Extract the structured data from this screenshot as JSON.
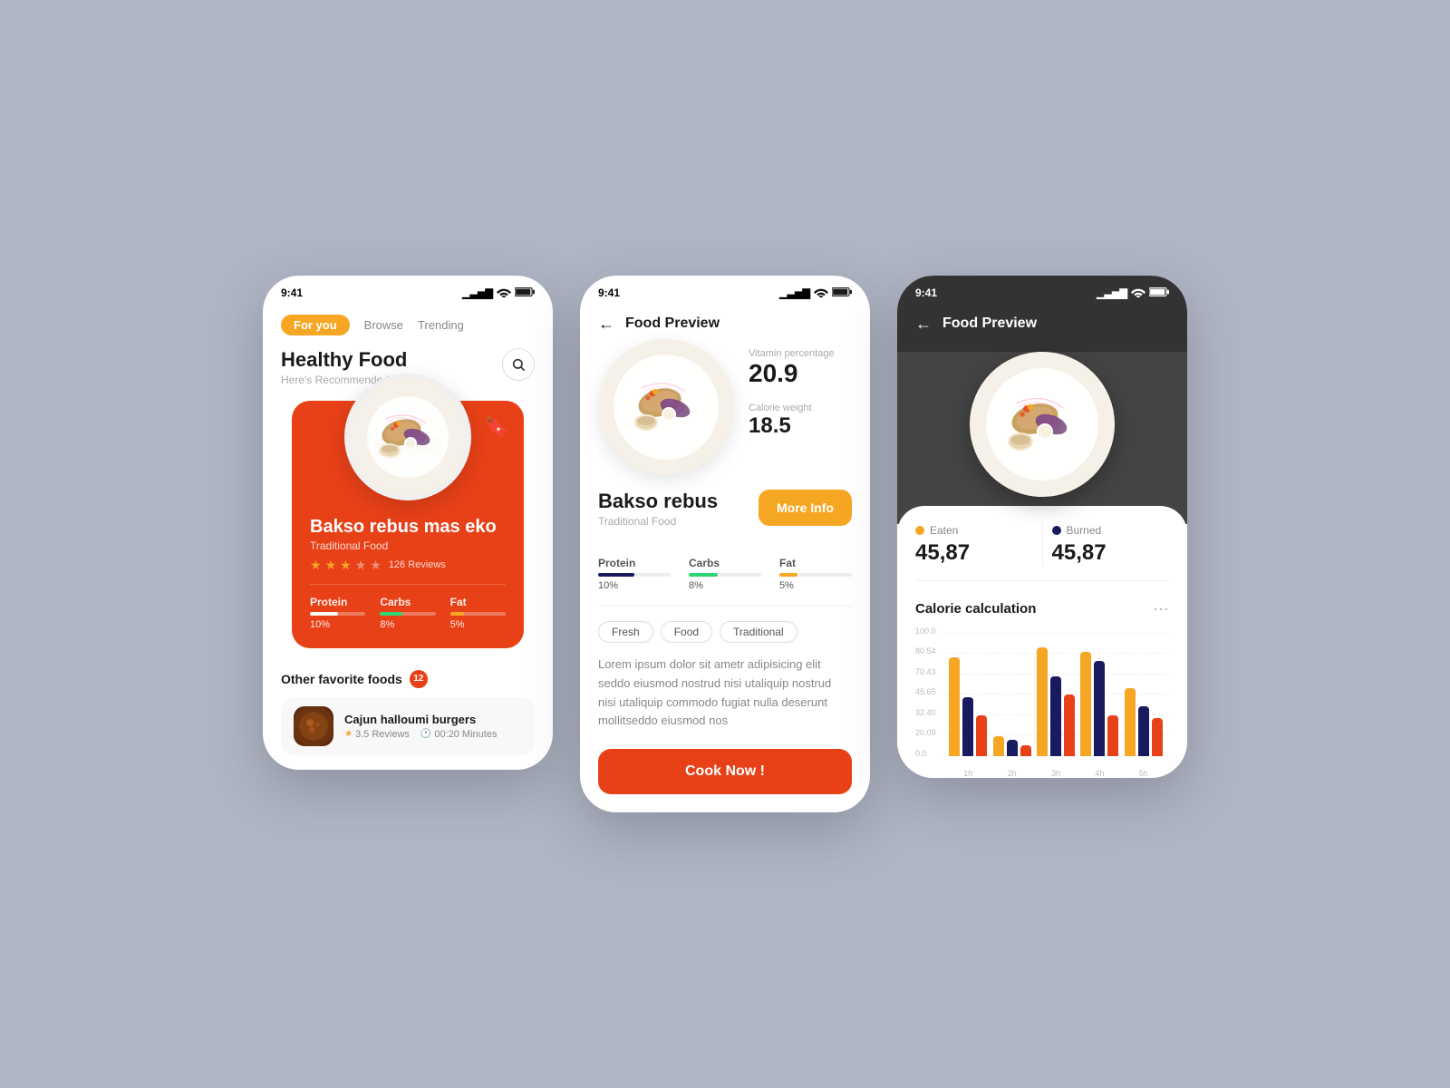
{
  "screens": {
    "screen1": {
      "status_time": "9:41",
      "tabs": [
        "For you",
        "Browse",
        "Trending"
      ],
      "active_tab": "For you",
      "header_title": "Healthy Food",
      "header_sub": "Here's Recommended for you",
      "hero": {
        "food_name": "Bakso rebus mas eko",
        "food_type": "Traditional Food",
        "rating": 2.5,
        "reviews": "126 Reviews",
        "nutrition": [
          {
            "label": "Protein",
            "pct": 10,
            "color": "#fff"
          },
          {
            "label": "Carbs",
            "pct": 8,
            "color": "#2ed573"
          },
          {
            "label": "Fat",
            "pct": 5,
            "color": "#f5a623"
          }
        ]
      },
      "other_foods_label": "Other favorite foods",
      "other_foods_count": "12",
      "food_list": [
        {
          "name": "Cajun halloumi burgers",
          "rating": "3.5 Reviews",
          "time": "00:20 Minutes"
        }
      ]
    },
    "screen2": {
      "status_time": "9:41",
      "header_title": "Food Preview",
      "back_label": "←",
      "vitamin_label": "Vitamin percentage",
      "vitamin_value": "20.9",
      "calorie_label": "Calorie weight",
      "calorie_value": "18.5",
      "food_name": "Bakso rebus",
      "food_type": "Traditional Food",
      "more_info_label": "More Info",
      "nutrition": [
        {
          "label": "Protein",
          "pct": 10,
          "color": "#1a1a5e"
        },
        {
          "label": "Carbs",
          "pct": 8,
          "color": "#2ed573"
        },
        {
          "label": "Fat",
          "pct": 5,
          "color": "#f5a623"
        }
      ],
      "tags": [
        "Fresh",
        "Food",
        "Traditional"
      ],
      "description": "Lorem ipsum dolor sit ametr adipisicing elit seddo eiusmod nostrud nisi utaliquip nostrud nisi utaliquip commodo fugiat nulla deserunt mollitseddo eiusmod nos",
      "cook_btn": "Cook Now !"
    },
    "screen3": {
      "status_time": "9:41",
      "header_title": "Food Preview",
      "back_label": "←",
      "eaten_label": "Eaten",
      "eaten_value": "45,87",
      "burned_label": "Burned",
      "burned_value": "45,87",
      "calorie_title": "Calorie calculation",
      "chart": {
        "y_labels": [
          "100.0",
          "80.54",
          "70.43",
          "45.65",
          "32.40",
          "20.09",
          "0.0"
        ],
        "x_labels": [
          "1h",
          "2h",
          "3h",
          "4h",
          "5h"
        ],
        "bar_groups": [
          [
            75,
            55,
            40
          ],
          [
            20,
            15,
            10
          ],
          [
            90,
            70,
            55
          ],
          [
            85,
            80,
            38
          ],
          [
            60,
            45,
            35
          ]
        ],
        "colors": [
          "#f5a623",
          "#1a1a5e",
          "#e84118"
        ]
      }
    }
  },
  "icons": {
    "search": "🔍",
    "back_arrow": "←",
    "bookmark": "🔖",
    "star_full": "★",
    "star_empty": "☆",
    "clock": "🕐",
    "more_dots": "···",
    "signal": "▎▎▎▎",
    "wifi": "📶",
    "battery": "🔋"
  }
}
